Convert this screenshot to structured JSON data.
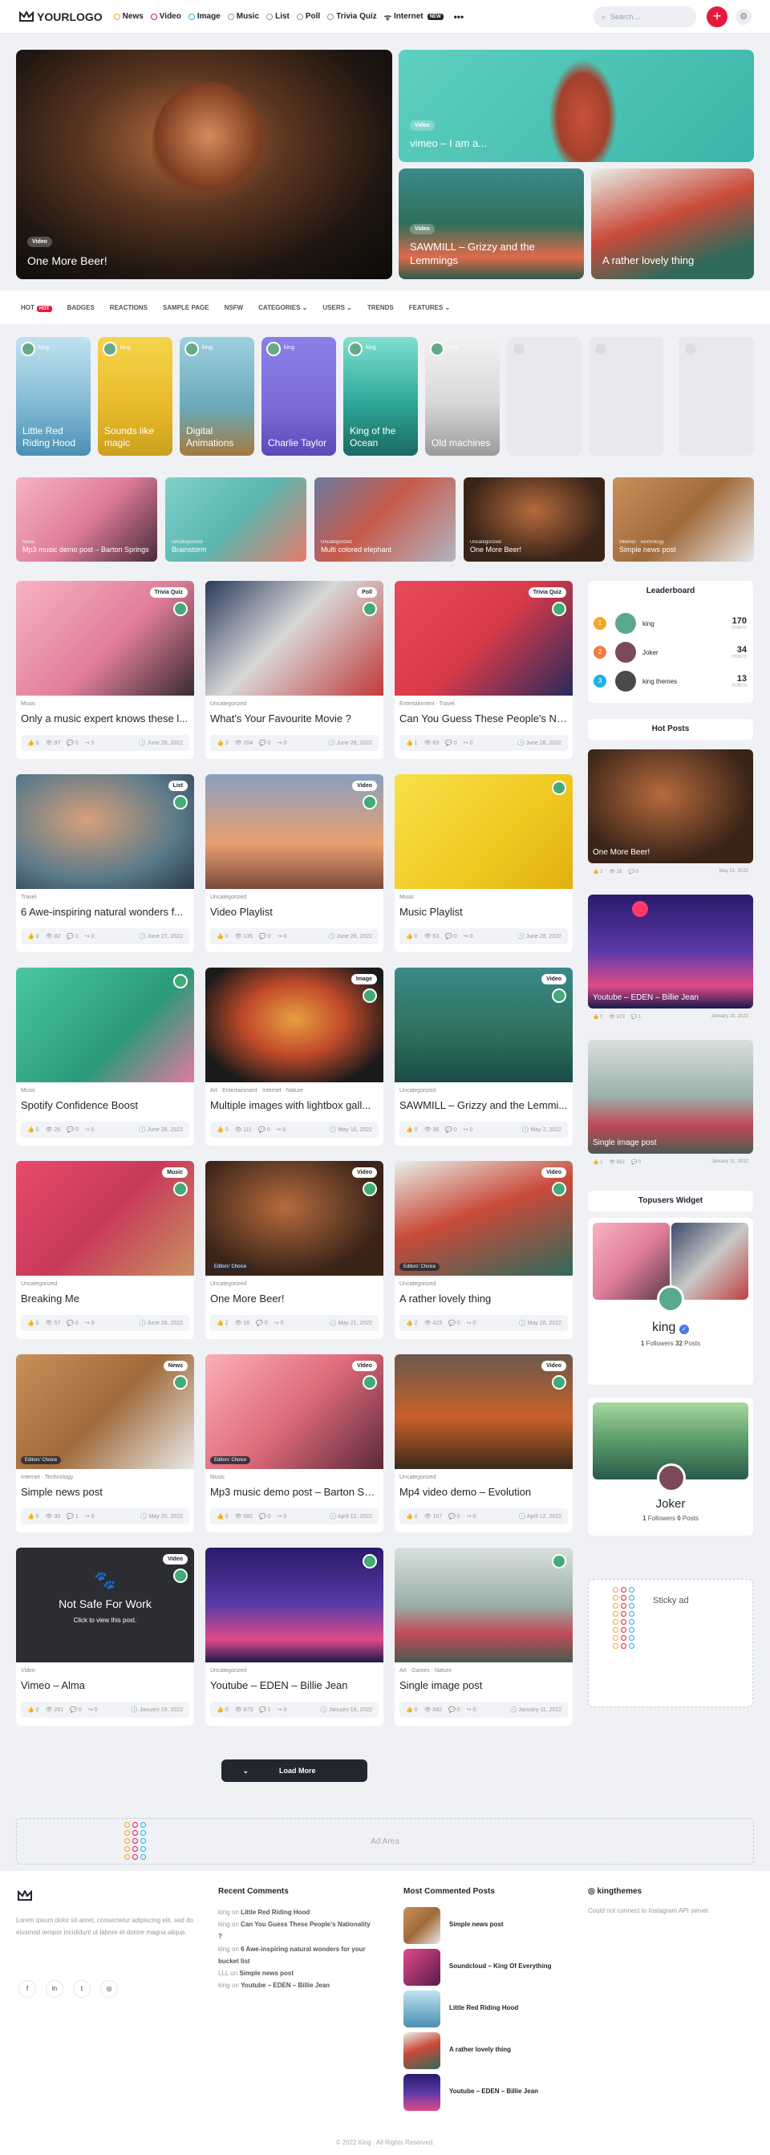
{
  "header": {
    "logo_text": "YOURLOGO",
    "nav": [
      {
        "label": "News",
        "color": "#f5a623"
      },
      {
        "label": "Video",
        "color": "#e5193b"
      },
      {
        "label": "Image",
        "color": "#1ab3e6"
      },
      {
        "label": "Music",
        "color": "#888888"
      },
      {
        "label": "List",
        "color": "#888888"
      },
      {
        "label": "Poll",
        "color": "#888888"
      },
      {
        "label": "Trivia Quiz",
        "color": "#888888"
      },
      {
        "label": "Internet",
        "badge": "NEW"
      }
    ],
    "more": "•••",
    "search_placeholder": "Search...",
    "plus_label": "+",
    "settings_label": "⚙"
  },
  "hero": [
    {
      "pill": "Video",
      "title": "One More Beer!"
    },
    {
      "pill": "Video",
      "title": "vimeo – I am a..."
    },
    {
      "pill": "Video",
      "title": "SAWMILL – Grizzy and the Lemmings"
    },
    {
      "pill": "",
      "title": "A rather lovely thing"
    }
  ],
  "subnav": {
    "items": [
      "HOT",
      "BADGES",
      "REACTIONS",
      "SAMPLE PAGE",
      "NSFW",
      "CATEGORIES",
      "USERS",
      "TRENDS",
      "FEATURES"
    ],
    "hot_badge": "HOT"
  },
  "stories": [
    {
      "user": "king",
      "title": "Little Red Riding Hood"
    },
    {
      "user": "king",
      "title": "Sounds like magic"
    },
    {
      "user": "king",
      "title": "Digital Animations"
    },
    {
      "user": "king",
      "title": "Charlie Taylor"
    },
    {
      "user": "king",
      "title": "King of the Ocean"
    },
    {
      "user": "king",
      "title": "Old machines"
    }
  ],
  "categories_strip": [
    {
      "cat": "Music",
      "title": "Mp3 music demo post – Barton Springs"
    },
    {
      "cat": "Uncategorized",
      "title": "Brainstorm"
    },
    {
      "cat": "Uncategorized",
      "title": "Multi colored elephant"
    },
    {
      "cat": "Uncategorized",
      "title": "One More Beer!"
    },
    {
      "cat": "Internet · Technology",
      "title": "Simple news post"
    }
  ],
  "cards": [
    {
      "tag": "Trivia Quiz",
      "cats": "Music",
      "title": "Only a music expert knows these l...",
      "likes": "0",
      "views": "97",
      "comments": "0",
      "shares": "0",
      "date": "June 28, 2022"
    },
    {
      "tag": "Poll",
      "cats": "Uncategorized",
      "title": "What's Your Favourite Movie ?",
      "likes": "3",
      "views": "204",
      "comments": "0",
      "shares": "0",
      "date": "June 28, 2022"
    },
    {
      "tag": "Trivia Quiz",
      "cats": "Entertainment · Travel",
      "title": "Can You Guess These People's Na...",
      "likes": "1",
      "views": "83",
      "comments": "0",
      "shares": "0",
      "date": "June 28, 2022"
    },
    {
      "tag": "List",
      "cats": "Travel",
      "title": "6 Awe-inspiring natural wonders f...",
      "likes": "0",
      "views": "82",
      "comments": "1",
      "shares": "0",
      "date": "June 27, 2022"
    },
    {
      "tag": "Video",
      "cats": "Uncategorized",
      "title": "Video Playlist",
      "likes": "0",
      "views": "135",
      "comments": "0",
      "shares": "0",
      "date": "June 28, 2022"
    },
    {
      "tag": "",
      "cats": "Music",
      "title": "Music Playlist",
      "likes": "0",
      "views": "63",
      "comments": "0",
      "shares": "0",
      "date": "June 28, 2022"
    },
    {
      "tag": "",
      "cats": "Music",
      "title": "Spotify Confidence Boost",
      "likes": "0",
      "views": "26",
      "comments": "0",
      "shares": "0",
      "date": "June 28, 2022"
    },
    {
      "tag": "Image",
      "cats": "Art · Entertainment · Internet · Nature",
      "title": "Multiple images with lightbox gall...",
      "likes": "0",
      "views": "111",
      "comments": "0",
      "shares": "0",
      "date": "May 10, 2022"
    },
    {
      "tag": "Video",
      "cats": "Uncategorized",
      "title": "SAWMILL – Grizzy and the Lemmi...",
      "likes": "0",
      "views": "36",
      "comments": "0",
      "shares": "0",
      "date": "May 2, 2022"
    },
    {
      "tag": "Music",
      "cats": "Uncategorized",
      "title": "Breaking Me",
      "likes": "0",
      "views": "57",
      "comments": "0",
      "shares": "0",
      "date": "June 28, 2022"
    },
    {
      "tag": "Video",
      "cats": "Uncategorized",
      "title": "One More Beer!",
      "likes": "2",
      "views": "16",
      "comments": "0",
      "shares": "0",
      "date": "May 21, 2022"
    },
    {
      "tag": "Video",
      "cats": "Uncategorized",
      "title": "A rather lovely thing",
      "likes": "2",
      "views": "423",
      "comments": "0",
      "shares": "0",
      "date": "May 20, 2022"
    },
    {
      "tag": "News",
      "cats": "Internet · Technology",
      "title": "Simple news post",
      "likes": "0",
      "views": "30",
      "comments": "1",
      "shares": "0",
      "date": "May 20, 2022"
    },
    {
      "tag": "Video",
      "cats": "Music",
      "title": "Mp3 music demo post – Barton Sp...",
      "likes": "0",
      "views": "582",
      "comments": "0",
      "shares": "0",
      "date": "April 12, 2022"
    },
    {
      "tag": "Video",
      "cats": "Uncategorized",
      "title": "Mp4 video demo – Evolution",
      "likes": "0",
      "views": "107",
      "comments": "0",
      "shares": "0",
      "date": "April 12, 2022"
    },
    {
      "tag": "Video",
      "cats": "Video",
      "title": "Vimeo – Alma",
      "likes": "0",
      "views": "281",
      "comments": "0",
      "shares": "0",
      "date": "January 19, 2022"
    },
    {
      "tag": "",
      "cats": "Uncategorized",
      "title": "Youtube – EDEN – Billie Jean",
      "likes": "0",
      "views": "873",
      "comments": "1",
      "shares": "0",
      "date": "January 19, 2022"
    },
    {
      "tag": "",
      "cats": "Art · Games · Nature",
      "title": "Single image post",
      "likes": "0",
      "views": "682",
      "comments": "0",
      "shares": "0",
      "date": "January 11, 2022"
    }
  ],
  "editors_choice": "Editors' Choice",
  "nsfw": {
    "title": "Not Safe For Work",
    "sub": "Click to view this post."
  },
  "sidebar": {
    "leaderboard_title": "Leaderboard",
    "leaders": [
      {
        "rank": "1",
        "name": "king",
        "points": "170",
        "color": "#f5a623"
      },
      {
        "rank": "2",
        "name": "Joker",
        "points": "34",
        "color": "#f07b3f"
      },
      {
        "rank": "3",
        "name": "king themes",
        "points": "13",
        "color": "#1ab3e6"
      }
    ],
    "points_label": "POINTS",
    "hot_title": "Hot Posts",
    "hot": [
      {
        "title": "One More Beer!",
        "likes": "2",
        "views": "16",
        "comments": "0",
        "date": "May 21, 2022"
      },
      {
        "title": "Youtube – EDEN – Billie Jean",
        "likes": "0",
        "views": "873",
        "comments": "1",
        "date": "January 19, 2022"
      },
      {
        "title": "Single image post",
        "likes": "1",
        "views": "682",
        "comments": "0",
        "date": "January 11, 2022"
      }
    ],
    "top_title": "Topusers Widget",
    "users": [
      {
        "name": "king",
        "followers": "1",
        "posts": "32"
      },
      {
        "name": "Joker",
        "followers": "1",
        "posts": "0"
      }
    ],
    "followers_label": "Followers",
    "posts_label": "Posts",
    "sticky": "Sticky ad"
  },
  "load_more": "Load More",
  "ad_area": "Ad Area",
  "footer": {
    "about": "Lorem ipsum dolor sit amet, consectetur adipiscing elit, sed do eiusmod tempor incididunt ut labore et dolore magna aliqua.",
    "social": [
      "f",
      "in",
      "t",
      "◎"
    ],
    "recent_title": "Recent Comments",
    "recent": [
      {
        "who": "king",
        "on": "on",
        "post": "Little Red Riding Hood"
      },
      {
        "who": "king",
        "on": "on",
        "post": "Can You Guess These People's Nationality ?"
      },
      {
        "who": "king",
        "on": "on",
        "post": "6 Awe-inspiring natural wonders for your bucket list"
      },
      {
        "who": "LLL",
        "on": "on",
        "post": "Simple news post"
      },
      {
        "who": "king",
        "on": "on",
        "post": "Youtube – EDEN – Billie Jean"
      }
    ],
    "most_title": "Most Commented Posts",
    "most": [
      "Simple news post",
      "Soundcloud – King Of Everything",
      "Little Red Riding Hood",
      "A rather lovely thing",
      "Youtube – EDEN – Billie Jean"
    ],
    "insta_title": "kingthemes",
    "insta_error": "Could not connect to Instagram API server.",
    "copyright": "© 2022 King . All Rights Reserved."
  }
}
